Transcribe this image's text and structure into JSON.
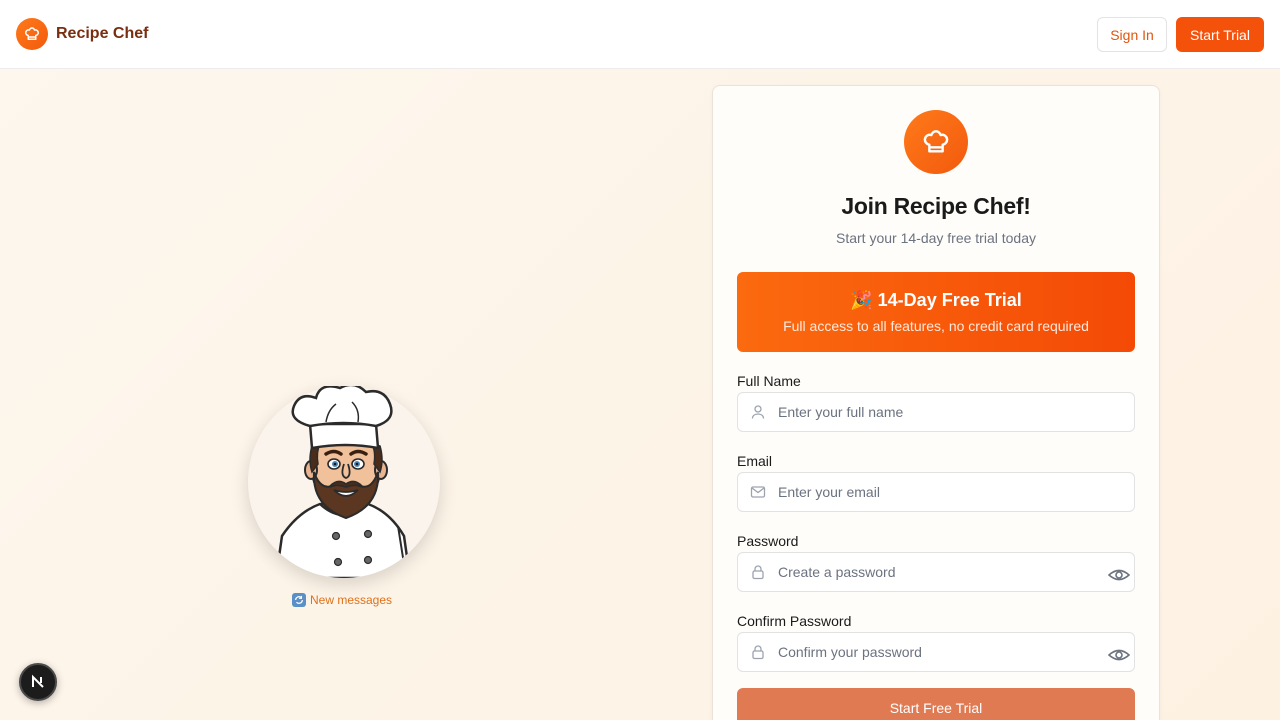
{
  "header": {
    "brand_name": "Recipe Chef",
    "logo_icon": "chef-hat-icon",
    "signin_label": "Sign In",
    "trial_label": "Start Trial"
  },
  "left": {
    "illustration": "chef-avatar",
    "new_messages_label": "New messages",
    "new_messages_icon": "refresh-messages-icon"
  },
  "card": {
    "logo_icon": "chef-hat-icon",
    "title": "Join Recipe Chef!",
    "subtitle": "Start your 14-day free trial today",
    "promo": {
      "title": "🎉 14-Day Free Trial",
      "description": "Full access to all features, no credit card required"
    },
    "fields": [
      {
        "label": "Full Name",
        "placeholder": "Enter your full name",
        "icon": "user-icon"
      },
      {
        "label": "Email",
        "placeholder": "Enter your email",
        "icon": "mail-icon"
      },
      {
        "label": "Password",
        "placeholder": "Create a password",
        "icon": "lock-icon"
      },
      {
        "label": "Confirm Password",
        "placeholder": "Confirm your password",
        "icon": "lock-icon"
      }
    ],
    "submit_label": "Start Free Trial"
  },
  "colors": {
    "accent": "#f4510b",
    "brand_text": "#7a2e10",
    "submit_bg": "#e07a52",
    "background": "#fdf4e8"
  }
}
